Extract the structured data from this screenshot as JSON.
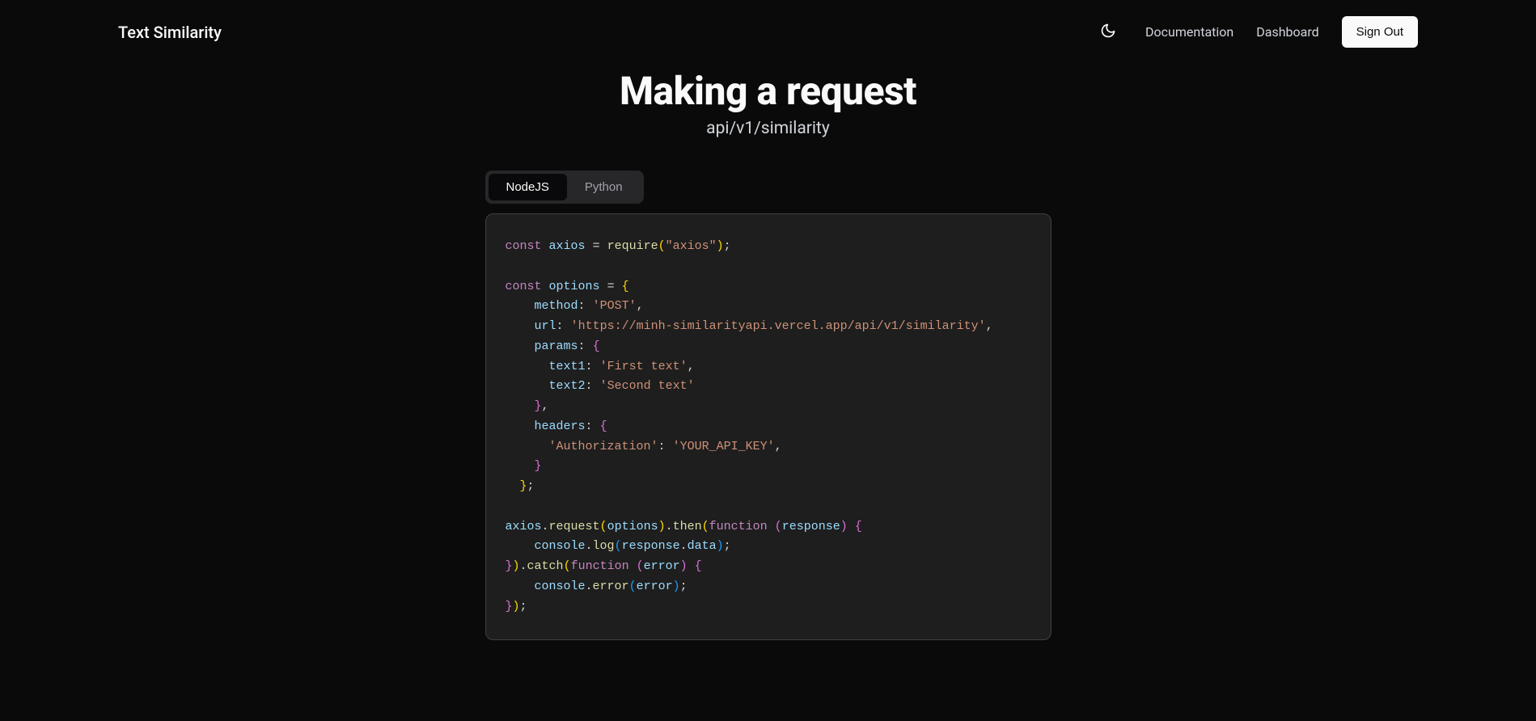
{
  "navbar": {
    "brand": "Text Similarity",
    "links": {
      "documentation": "Documentation",
      "dashboard": "Dashboard"
    },
    "signOut": "Sign Out"
  },
  "page": {
    "title": "Making a request",
    "subtitle": "api/v1/similarity"
  },
  "tabs": {
    "nodejs": "NodeJS",
    "python": "Python"
  },
  "code": {
    "const1": "const",
    "axios": "axios",
    "eq": "=",
    "require": "require",
    "axiosStr": "\"axios\"",
    "semi": ";",
    "const2": "const",
    "options": "options",
    "methodKey": "method",
    "colon": ":",
    "methodVal": "'POST'",
    "comma": ",",
    "urlKey": "url",
    "urlVal": "'https://minh-similarityapi.vercel.app/api/v1/similarity'",
    "paramsKey": "params",
    "text1Key": "text1",
    "text1Val": "'First text'",
    "text2Key": "text2",
    "text2Val": "'Second text'",
    "headersKey": "headers",
    "authKey": "'Authorization'",
    "authVal": "'YOUR_API_KEY'",
    "request": "request",
    "then": "then",
    "function": "function",
    "response": "response",
    "console": "console",
    "log": "log",
    "data": "data",
    "catch": "catch",
    "error": "error",
    "errorFn": "error",
    "dot": ".",
    "lparen": "(",
    "rparen": ")",
    "lbrace": "{",
    "rbrace": "}",
    "lparen2": "(",
    "rparen2": ")"
  }
}
